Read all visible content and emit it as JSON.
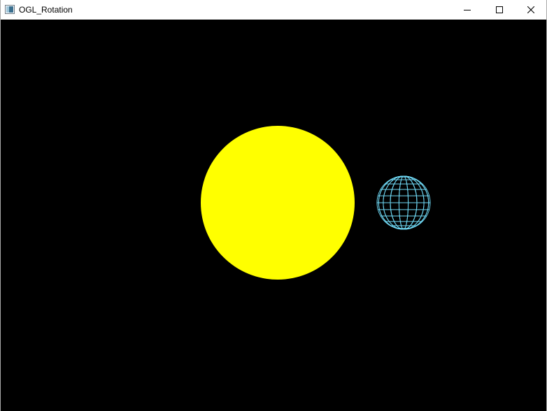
{
  "window": {
    "title": "OGL_Rotation",
    "controls": {
      "minimize": "minimize",
      "maximize": "maximize",
      "close": "close"
    }
  },
  "scene": {
    "background_color": "#000000",
    "sun": {
      "shape": "solid sphere",
      "color": "#ffff00"
    },
    "planet": {
      "shape": "wireframe sphere",
      "color": "#6fd8f4"
    }
  }
}
